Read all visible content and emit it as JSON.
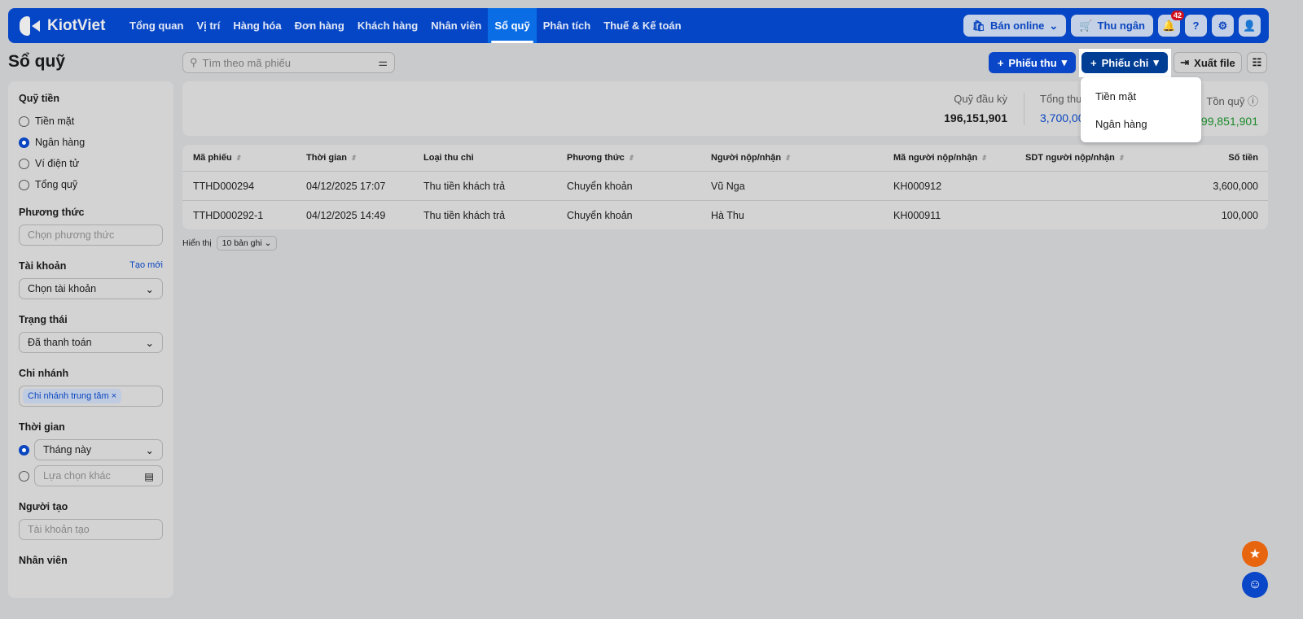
{
  "nav": {
    "brand": "KiotViet",
    "tabs": [
      "Tổng quan",
      "Vị trí",
      "Hàng hóa",
      "Đơn hàng",
      "Khách hàng",
      "Nhân viên",
      "Sổ quỹ",
      "Phân tích",
      "Thuế & Kế toán"
    ],
    "online": "Bán online",
    "cashier": "Thu ngân",
    "notifications": "42"
  },
  "page": {
    "title": "Sổ quỹ",
    "search_placeholder": "Tìm theo mã phiếu",
    "receipt": "Phiếu thu",
    "payment": "Phiếu chi",
    "export": "Xuất file"
  },
  "dropdown": [
    "Tiền mặt",
    "Ngân hàng"
  ],
  "sidebar": {
    "fund": {
      "label": "Quỹ tiền",
      "options": [
        "Tiền mặt",
        "Ngân hàng",
        "Ví điện tử",
        "Tổng quỹ"
      ],
      "selected": 1
    },
    "method": {
      "label": "Phương thức",
      "placeholder": "Chọn phương thức"
    },
    "account": {
      "label": "Tài khoản",
      "create": "Tạo mới",
      "value": "Chọn tài khoản"
    },
    "status": {
      "label": "Trạng thái",
      "value": "Đã thanh toán"
    },
    "branch": {
      "label": "Chi nhánh",
      "chip": "Chi nhánh trung tâm"
    },
    "time": {
      "label": "Thời gian",
      "value": "Tháng này",
      "other": "Lựa chọn khác"
    },
    "creator": {
      "label": "Người tạo",
      "placeholder": "Tài khoản tạo"
    },
    "staff": {
      "label": "Nhân viên"
    }
  },
  "summary": {
    "opening_label": "Quỹ đầu kỳ",
    "opening": "196,151,901",
    "income_label": "Tổng thu",
    "income": "3,700,000",
    "balance_label": "Tồn quỹ",
    "balance": "199,851,901",
    "income_color": "#0a46c0",
    "balance_color": "#1a8a2a"
  },
  "table": {
    "headers": [
      "Mã phiếu",
      "Thời gian",
      "Loại thu chi",
      "Phương thức",
      "Người nộp/nhận",
      "Mã người nộp/nhận",
      "SDT người nộp/nhận",
      "Số tiền"
    ],
    "rows": [
      [
        "TTHD000294",
        "04/12/2025 17:07",
        "Thu tiền khách trả",
        "Chuyển khoản",
        "Vũ Nga",
        "KH000912",
        "",
        "3,600,000"
      ],
      [
        "TTHD000292-1",
        "04/12/2025 14:49",
        "Thu tiền khách trả",
        "Chuyển khoản",
        "Hà Thu",
        "KH000911",
        "",
        "100,000"
      ]
    ]
  },
  "pager": {
    "label": "Hiển thị",
    "value": "10 bản ghi"
  }
}
